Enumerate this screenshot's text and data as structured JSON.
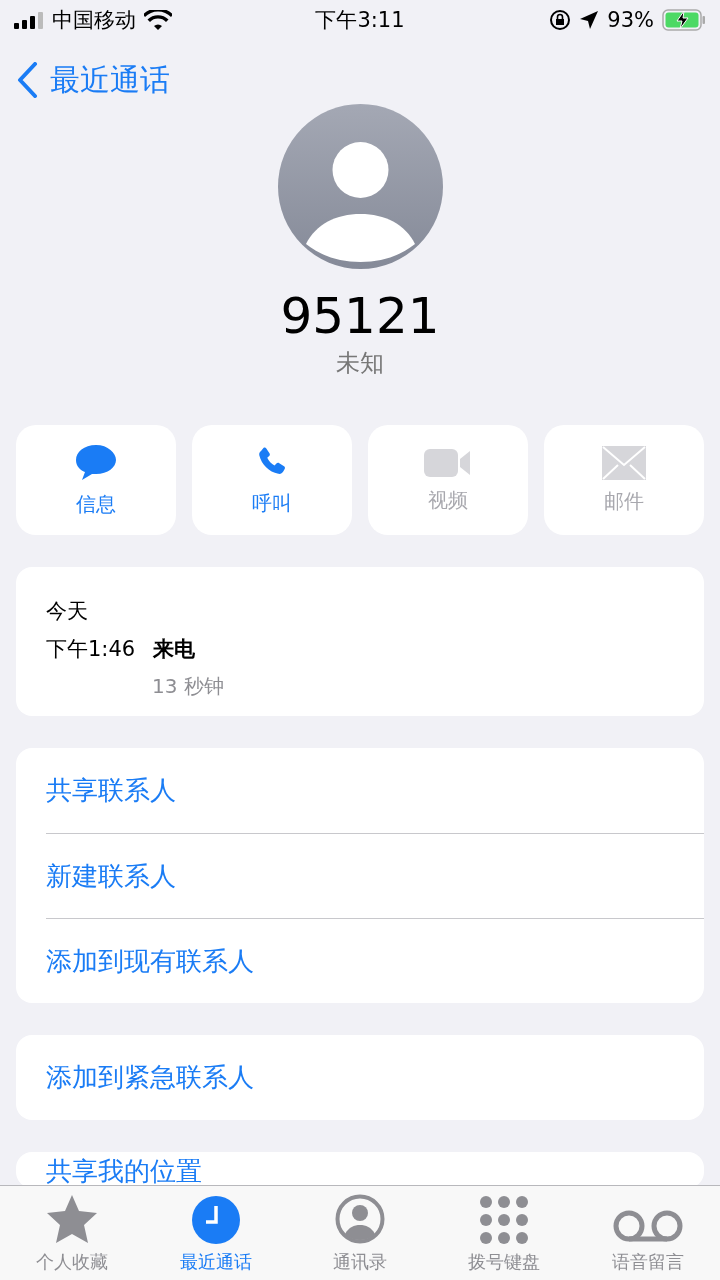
{
  "status_bar": {
    "carrier": "中国移动",
    "time": "下午3:11",
    "battery": "93%"
  },
  "nav": {
    "back": "最近通话"
  },
  "contact": {
    "number": "95121",
    "label": "未知"
  },
  "actions": [
    {
      "kind": "message",
      "label": "信息",
      "disabled": false
    },
    {
      "kind": "phone",
      "label": "呼叫",
      "disabled": false
    },
    {
      "kind": "video",
      "label": "视频",
      "disabled": true
    },
    {
      "kind": "mail",
      "label": "邮件",
      "disabled": true
    }
  ],
  "call_log": {
    "date": "今天",
    "time": "下午1:46",
    "type": "来电",
    "duration": "13 秒钟"
  },
  "groups": [
    [
      "共享联系人",
      "新建联系人",
      "添加到现有联系人"
    ],
    [
      "添加到紧急联系人"
    ],
    [
      "共享我的位置"
    ]
  ],
  "tab_bar": [
    {
      "kind": "star",
      "label": "个人收藏",
      "selected": false
    },
    {
      "kind": "clock",
      "label": "最近通话",
      "selected": true
    },
    {
      "kind": "person",
      "label": "通讯录",
      "selected": false
    },
    {
      "kind": "keypad",
      "label": "拨号键盘",
      "selected": false
    },
    {
      "kind": "voicemail",
      "label": "语音留言",
      "selected": false
    }
  ]
}
